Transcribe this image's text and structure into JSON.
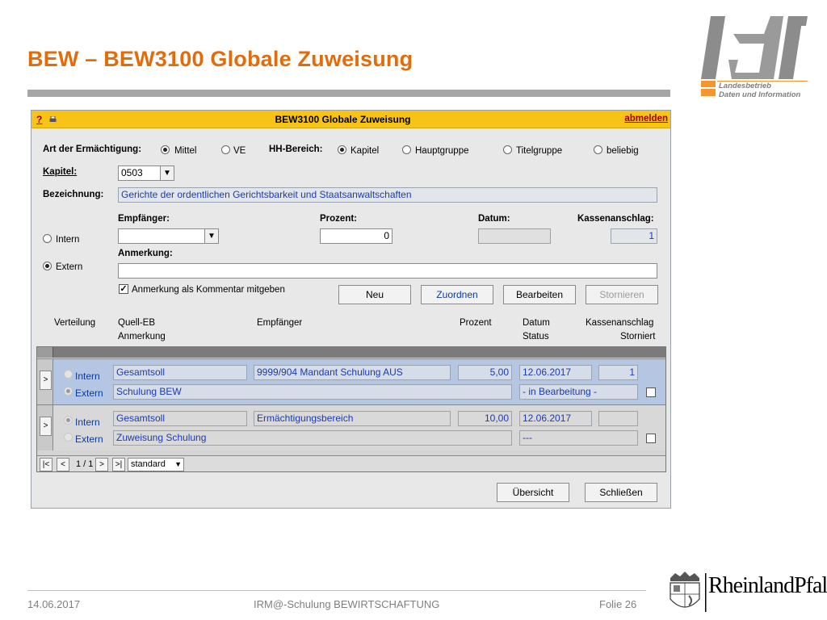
{
  "slide": {
    "title": "BEW – BEW3100 Globale Zuweisung",
    "logo_text_line1": "Landesbetrieb",
    "logo_text_line2": "Daten und Information",
    "state_logo_text": "RheinlandPfalz",
    "accent_color": "#e36c09"
  },
  "app": {
    "help": "?",
    "title": "BEW3100 Globale Zuweisung",
    "logout": "abmelden",
    "art_label": "Art der Ermächtigung:",
    "art_options": [
      "Mittel",
      "VE"
    ],
    "art_selected": "Mittel",
    "hh_label": "HH-Bereich:",
    "hh_options": [
      "Kapitel",
      "Hauptgruppe",
      "Titelgruppe",
      "beliebig"
    ],
    "hh_selected": "Kapitel",
    "kapitel_label": "Kapitel:",
    "kapitel_value": "0503",
    "bezeichnung_label": "Bezeichnung:",
    "bezeichnung_value": "Gerichte der ordentlichen Gerichtsbarkeit und Staatsanwaltschaften",
    "empfaenger_label": "Empfänger:",
    "empfaenger_value": "",
    "prozent_label": "Prozent:",
    "prozent_value": "0",
    "datum_label": "Datum:",
    "datum_value": "",
    "kassen_label": "Kassenanschlag:",
    "kassen_value": "1",
    "intern_label": "Intern",
    "extern_label": "Extern",
    "ie_selected": "Extern",
    "anmerkung_label": "Anmerkung:",
    "anmerkung_value": "",
    "kommentar_label": "Anmerkung als Kommentar mitgeben",
    "kommentar_checked": true,
    "buttons": {
      "neu": "Neu",
      "zuordnen": "Zuordnen",
      "bearbeiten": "Bearbeiten",
      "stornieren": "Stornieren"
    },
    "columns": {
      "verteilung": "Verteilung",
      "quell_eb": "Quell-EB",
      "anmerkung": "Anmerkung",
      "empfaenger": "Empfänger",
      "prozent": "Prozent",
      "datum": "Datum",
      "status": "Status",
      "kassenanschlag": "Kassenanschlag",
      "storniert": "Storniert"
    },
    "rows": [
      {
        "expand": ">",
        "intern": "Intern",
        "extern": "Extern",
        "selected": "Extern",
        "quell_eb": "Gesamtsoll",
        "empfaenger": "9999/904 Mandant Schulung AUS",
        "prozent": "5,00",
        "datum": "12.06.2017",
        "kassenanschlag": "1",
        "anmerkung": "Schulung BEW",
        "status": "- in Bearbeitung -"
      },
      {
        "expand": ">",
        "intern": "Intern",
        "extern": "Extern",
        "selected": "Intern",
        "quell_eb": "Gesamtsoll",
        "empfaenger": "Ermächtigungsbereich",
        "prozent": "10,00",
        "datum": "12.06.2017",
        "kassenanschlag": "",
        "anmerkung": "Zuweisung Schulung",
        "status": "---"
      }
    ],
    "pager": {
      "first": "|<",
      "prev": "<",
      "count": "1 / 1",
      "next": ">",
      "last": ">|",
      "view": "standard"
    },
    "uebersicht": "Übersicht",
    "schliessen": "Schließen"
  },
  "footer": {
    "date": "14.06.2017",
    "center": "IRM@-Schulung BEWIRTSCHAFTUNG",
    "slide_no": "Folie 26"
  }
}
